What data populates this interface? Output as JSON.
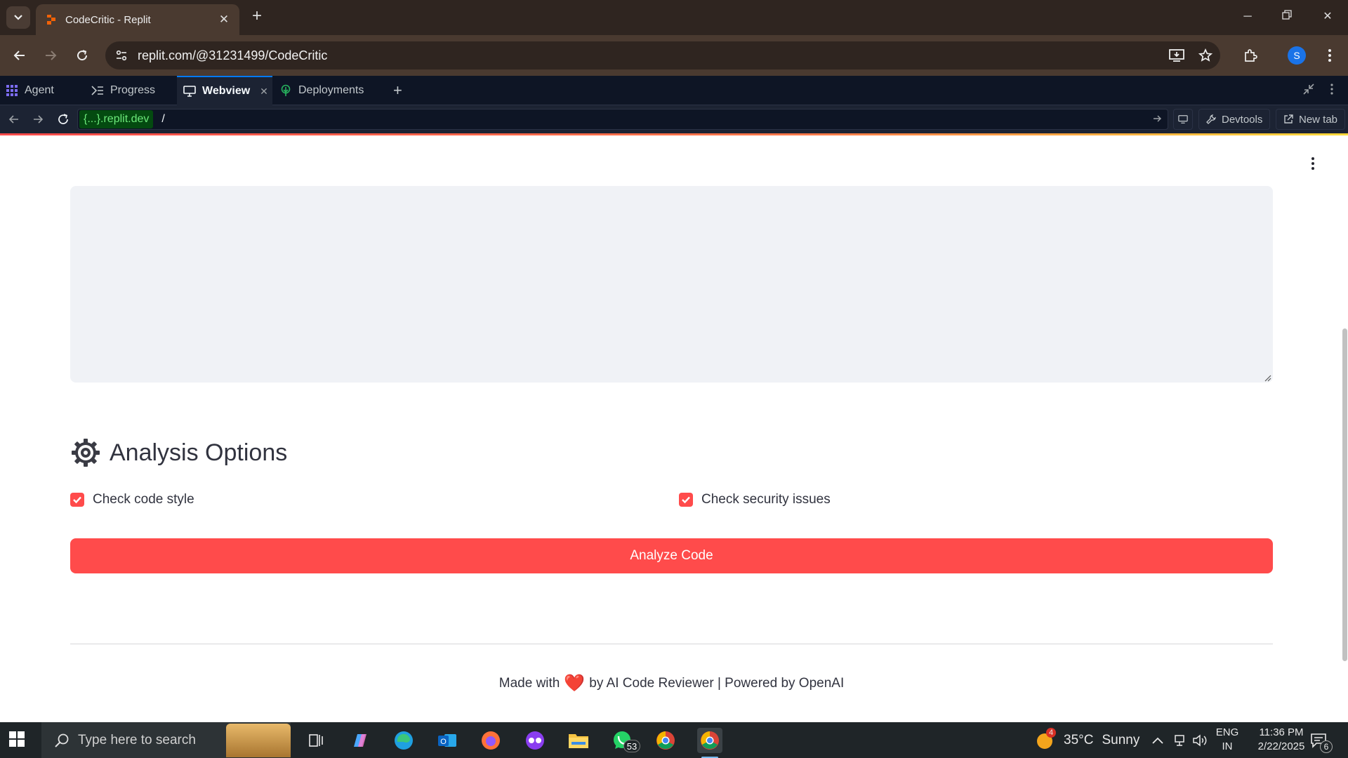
{
  "browser": {
    "tab_title": "CodeCritic - Replit",
    "url": "replit.com/@31231499/CodeCritic",
    "profile_initial": "S"
  },
  "replit": {
    "tabs": [
      {
        "label": "Agent",
        "icon": "agent-grid-icon"
      },
      {
        "label": "Progress",
        "icon": "progress-icon"
      },
      {
        "label": "Webview",
        "icon": "monitor-icon",
        "active": true
      },
      {
        "label": "Deployments",
        "icon": "deployments-icon"
      }
    ],
    "webview": {
      "host": "{...}.replit.dev",
      "path": "/",
      "devtools_label": "Devtools",
      "newtab_label": "New tab"
    }
  },
  "app": {
    "code_input_value": "",
    "section_title": "Analysis Options",
    "options": [
      {
        "label": "Check code style",
        "checked": true
      },
      {
        "label": "Check security issues",
        "checked": true
      }
    ],
    "analyze_button": "Analyze Code",
    "footer": {
      "made_with": "Made with",
      "heart": "❤️",
      "rest": "by AI Code Reviewer | Powered by OpenAI"
    },
    "accent_color": "#ff4b4b"
  },
  "taskbar": {
    "search_placeholder": "Type here to search",
    "weather_temp": "35°C",
    "weather_desc": "Sunny",
    "weather_badge": "4",
    "lang": "ENG",
    "region": "IN",
    "time": "11:36 PM",
    "date": "2/22/2025",
    "whatsapp_badge": "53",
    "notification_count": "6"
  }
}
